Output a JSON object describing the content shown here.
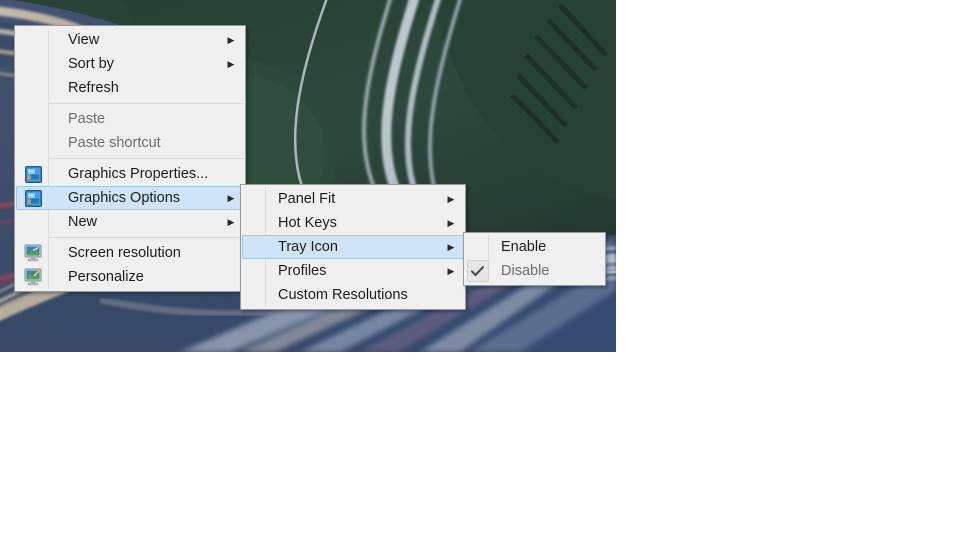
{
  "desktop": {
    "wallpaper_name": "highway-light-trails-wallpaper",
    "wallpaper_colors": {
      "road": "#40506e",
      "foliage": "#2d4a3e",
      "sky_tint": "#3b5a86",
      "trail_warm": "#f0e2c8",
      "trail_cool": "#dfe8f2",
      "trail_red": "#b4445a"
    }
  },
  "context_menu": {
    "name": "desktop-context-menu",
    "items": [
      {
        "label": "View",
        "icon": "",
        "submenu": true,
        "disabled": false,
        "highlighted": false
      },
      {
        "label": "Sort by",
        "icon": "",
        "submenu": true,
        "disabled": false,
        "highlighted": false
      },
      {
        "label": "Refresh",
        "icon": "",
        "submenu": false,
        "disabled": false,
        "highlighted": false
      },
      {
        "label": "Paste",
        "icon": "",
        "submenu": false,
        "disabled": true,
        "highlighted": false
      },
      {
        "label": "Paste shortcut",
        "icon": "",
        "submenu": false,
        "disabled": true,
        "highlighted": false
      },
      {
        "label": "Graphics Properties...",
        "icon": "intel-graphics-icon",
        "submenu": false,
        "disabled": false,
        "highlighted": false
      },
      {
        "label": "Graphics Options",
        "icon": "intel-graphics-icon",
        "submenu": true,
        "disabled": false,
        "highlighted": true
      },
      {
        "label": "New",
        "icon": "",
        "submenu": true,
        "disabled": false,
        "highlighted": false
      },
      {
        "label": "Screen resolution",
        "icon": "monitor-icon",
        "submenu": false,
        "disabled": false,
        "highlighted": false
      },
      {
        "label": "Personalize",
        "icon": "monitor-paint-icon",
        "submenu": false,
        "disabled": false,
        "highlighted": false
      }
    ]
  },
  "submenu_graphics_options": {
    "name": "graphics-options-submenu",
    "items": [
      {
        "label": "Panel Fit",
        "submenu": true,
        "highlighted": false
      },
      {
        "label": "Hot Keys",
        "submenu": true,
        "highlighted": false
      },
      {
        "label": "Tray Icon",
        "submenu": true,
        "highlighted": true
      },
      {
        "label": "Profiles",
        "submenu": true,
        "highlighted": false
      },
      {
        "label": "Custom Resolutions",
        "submenu": false,
        "highlighted": false
      }
    ]
  },
  "submenu_tray_icon": {
    "name": "tray-icon-submenu",
    "items": [
      {
        "label": "Enable",
        "checked": false,
        "disabled": false
      },
      {
        "label": "Disable",
        "checked": true,
        "disabled": true
      }
    ]
  },
  "theme": {
    "menu_background": "#f0f0f0",
    "menu_border": "#9a9a9a",
    "highlight_fill": "#cfe5f5",
    "highlight_border": "#99c9e4",
    "text_color": "#1c1c1c",
    "disabled_text_color": "#6d6d6d",
    "separator_color": "#d8d8d8"
  },
  "glyphs": {
    "submenu_arrow": "▶",
    "checkmark": "✔"
  }
}
